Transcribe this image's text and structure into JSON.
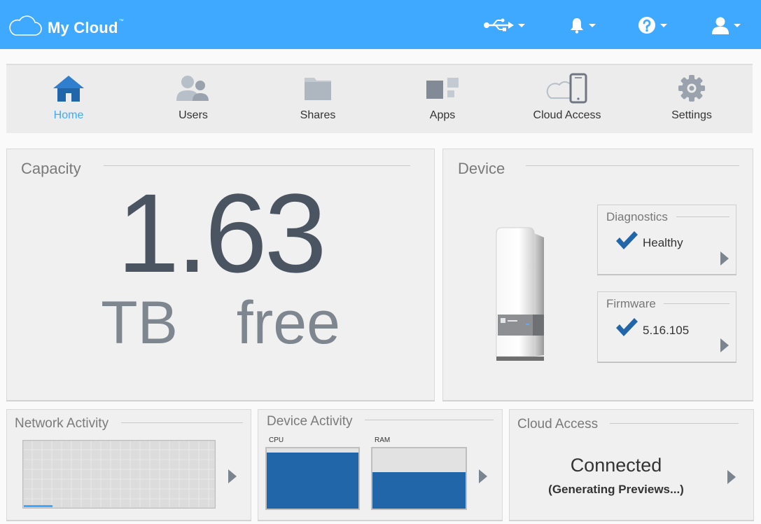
{
  "app": {
    "title": "My Cloud",
    "trademark": "™"
  },
  "nav": {
    "items": [
      {
        "label": "Home",
        "icon": "home-icon"
      },
      {
        "label": "Users",
        "icon": "users-icon"
      },
      {
        "label": "Shares",
        "icon": "folder-icon"
      },
      {
        "label": "Apps",
        "icon": "apps-icon"
      },
      {
        "label": "Cloud Access",
        "icon": "cloud-device-icon"
      },
      {
        "label": "Settings",
        "icon": "gear-icon"
      }
    ]
  },
  "capacity": {
    "title": "Capacity",
    "value": "1.63",
    "unit": "TB  free"
  },
  "device": {
    "title": "Device",
    "diagnostics": {
      "title": "Diagnostics",
      "status": "Healthy"
    },
    "firmware": {
      "title": "Firmware",
      "version": "5.16.105"
    }
  },
  "network": {
    "title": "Network Activity",
    "usage_fraction": 0.15
  },
  "device_activity": {
    "title": "Device Activity",
    "cpu": {
      "label": "CPU",
      "fraction": 0.93
    },
    "ram": {
      "label": "RAM",
      "fraction": 0.6
    }
  },
  "cloud_access": {
    "title": "Cloud Access",
    "status": "Connected",
    "detail": "(Generating Previews...)"
  },
  "colors": {
    "accent": "#3fa9ff",
    "bar": "#2266aa",
    "check": "#2266aa"
  }
}
